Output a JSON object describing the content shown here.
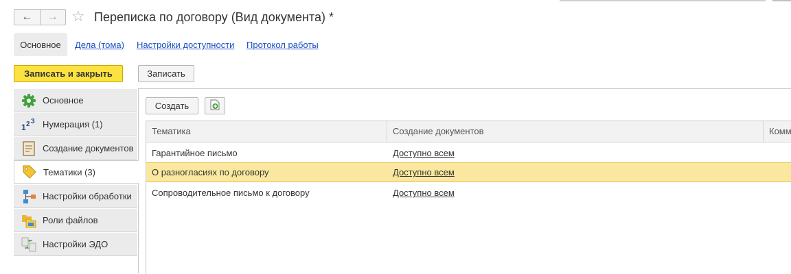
{
  "window": {
    "title": "Переписка по договору (Вид документа) *",
    "back_glyph": "←",
    "forward_glyph": "→",
    "star_glyph": "☆"
  },
  "section_tabs": {
    "main": "Основное",
    "links": [
      "Дела (тома)",
      "Настройки доступности",
      "Протокол работы"
    ]
  },
  "toolbar": {
    "save_close_label": "Записать и закрыть",
    "save_label": "Записать"
  },
  "sidebar": {
    "items": [
      {
        "label": "Основное",
        "icon": "gear-icon"
      },
      {
        "label": "Нумерация (1)",
        "icon": "numbering-icon"
      },
      {
        "label": "Создание документов",
        "icon": "document-icon"
      },
      {
        "label": "Тематики (3)",
        "icon": "tag-icon"
      },
      {
        "label": "Настройки обработки",
        "icon": "workflow-icon"
      },
      {
        "label": "Роли файлов",
        "icon": "folders-icon"
      },
      {
        "label": "Настройки ЭДО",
        "icon": "edo-icon"
      }
    ],
    "active_index": 3
  },
  "list_toolbar": {
    "create_label": "Создать"
  },
  "table": {
    "columns": [
      "Тематика",
      "Создание документов",
      "Комм"
    ],
    "rows": [
      {
        "topic": "Гарантийное письмо",
        "access": "Доступно всем"
      },
      {
        "topic": "О разногласиях по договору",
        "access": "Доступно всем"
      },
      {
        "topic": "Сопроводительное письмо к договору",
        "access": "Доступно всем"
      }
    ],
    "selected_index": 1
  },
  "colors": {
    "accent_yellow": "#fbe240",
    "selection": "#fbe8a0",
    "link": "#1a4dc4",
    "gear_green": "#3fa33a"
  }
}
